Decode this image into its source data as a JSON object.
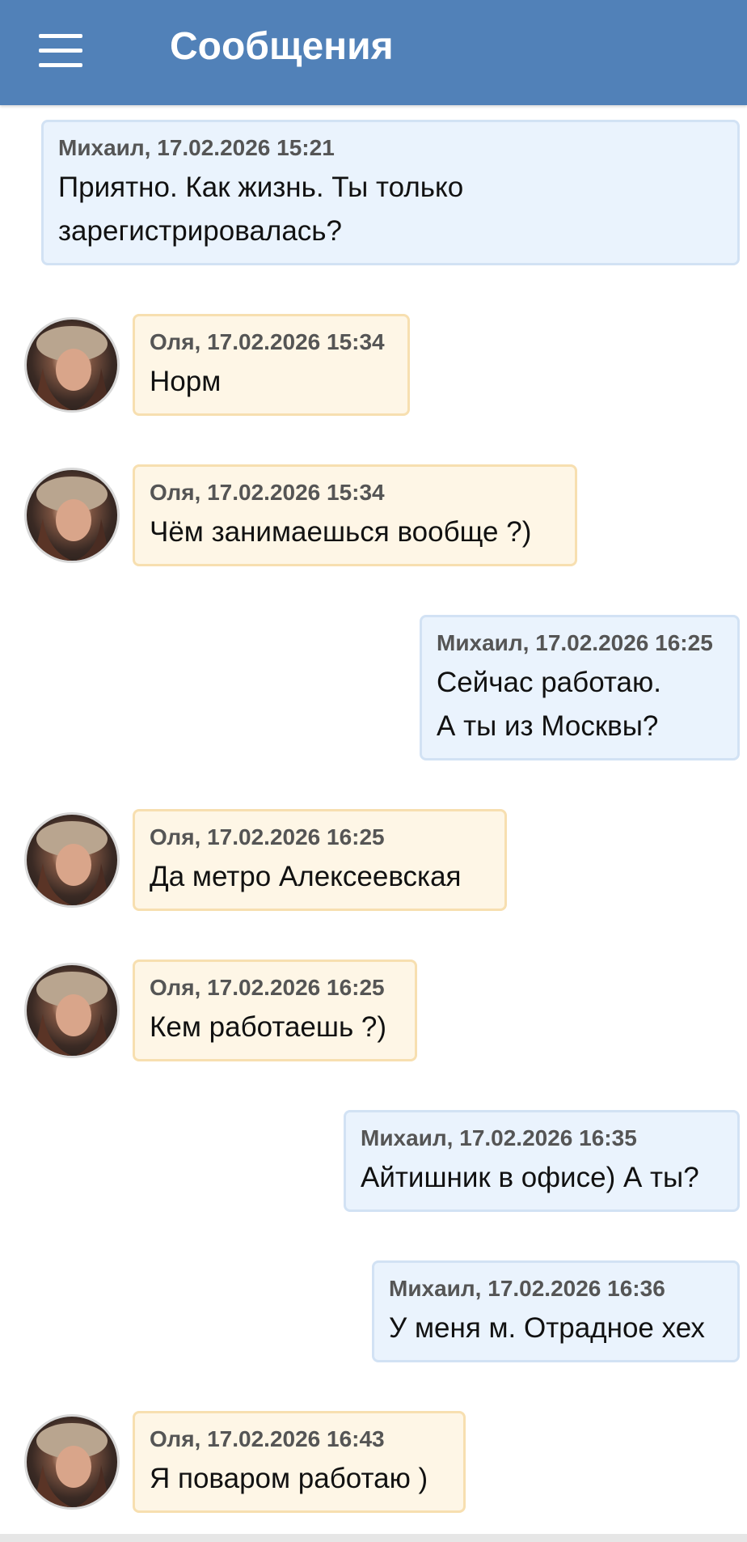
{
  "header": {
    "title": "Сообщения",
    "menu_icon": "hamburger-menu-icon",
    "background_color": "#5181b8"
  },
  "messages": [
    {
      "side": "out",
      "author": "Михаил",
      "meta": "Михаил, 17.02.2026 15:21",
      "text": "Приятно. Как жизнь. Ты только\nзарегистрировалась?"
    },
    {
      "side": "in",
      "author": "Оля",
      "meta": "Оля, 17.02.2026 15:34",
      "text": "Норм"
    },
    {
      "side": "in",
      "author": "Оля",
      "meta": "Оля, 17.02.2026 15:34",
      "text": "Чём занимаешься вообще ?)"
    },
    {
      "side": "out",
      "author": "Михаил",
      "meta": "Михаил, 17.02.2026 16:25",
      "text": "Сейчас работаю.\nА ты из Москвы?"
    },
    {
      "side": "in",
      "author": "Оля",
      "meta": "Оля, 17.02.2026 16:25",
      "text": "Да метро Алексеевская"
    },
    {
      "side": "in",
      "author": "Оля",
      "meta": "Оля, 17.02.2026 16:25",
      "text": "Кем работаешь ?)"
    },
    {
      "side": "out",
      "author": "Михаил",
      "meta": "Михаил, 17.02.2026 16:35",
      "text": "Айтишник в офисе) А ты?"
    },
    {
      "side": "out",
      "author": "Михаил",
      "meta": "Михаил, 17.02.2026 16:36",
      "text": "У меня м. Отрадное хех"
    },
    {
      "side": "in",
      "author": "Оля",
      "meta": "Оля, 17.02.2026 16:43",
      "text": "Я поваром работаю )"
    }
  ],
  "colors": {
    "outgoing_bubble": "#eaf3fd",
    "outgoing_border": "#d2e2f4",
    "incoming_bubble": "#fef6e6",
    "incoming_border": "#f7dfb0"
  }
}
